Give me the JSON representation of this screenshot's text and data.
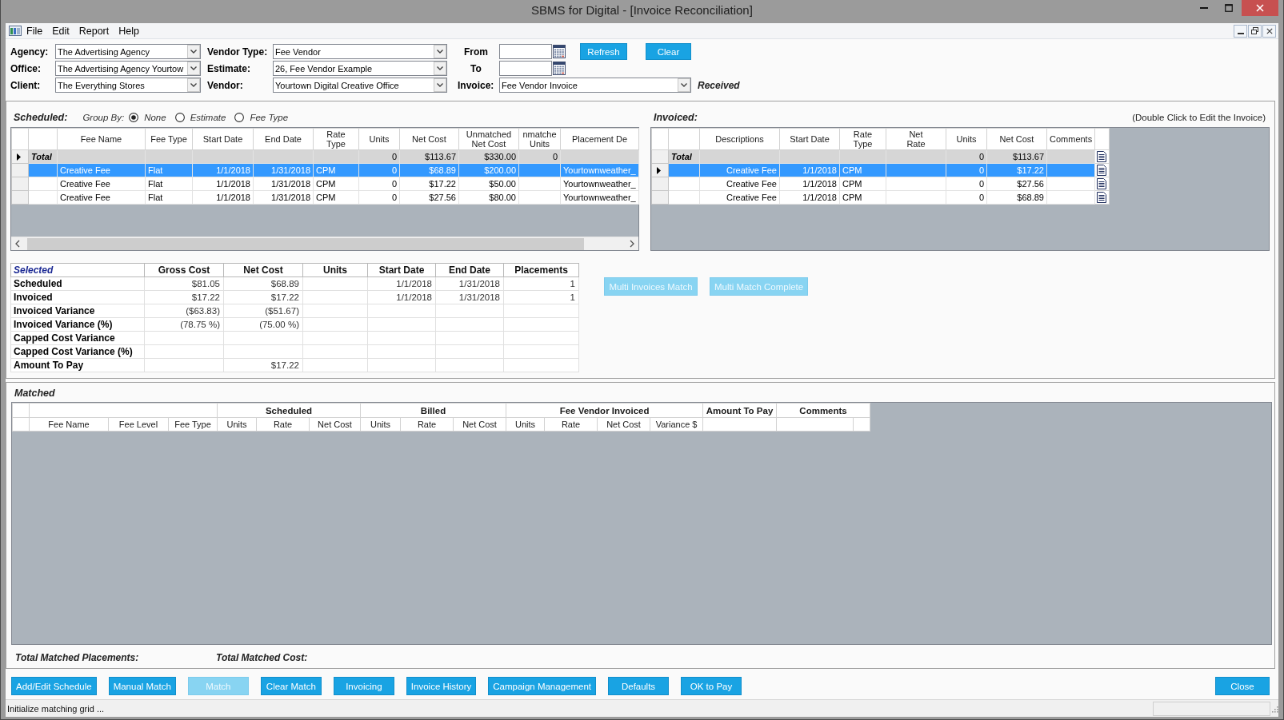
{
  "window": {
    "title": "SBMS for Digital - [Invoice Reconciliation]"
  },
  "menu": [
    "File",
    "Edit",
    "Report",
    "Help"
  ],
  "filters": {
    "account": [
      {
        "label": "Agency:",
        "value": "The Advertising Agency"
      },
      {
        "label": "Office:",
        "value": "The Advertising Agency Yourtow"
      },
      {
        "label": "Client:",
        "value": "The Everything Stores"
      }
    ],
    "vendor": [
      {
        "label": "Vendor Type:",
        "value": "Fee Vendor"
      },
      {
        "label": "Estimate:",
        "value": "26, Fee Vendor Example"
      },
      {
        "label": "Vendor:",
        "value": "Yourtown Digital Creative Office"
      }
    ],
    "date_range": [
      {
        "label": "From"
      },
      {
        "label": "To"
      }
    ],
    "buttons": [
      "Refresh",
      "Clear"
    ],
    "invoice": {
      "label": "Invoice:",
      "value": "Fee Vendor Invoice",
      "status": "Received"
    }
  },
  "scheduled": {
    "title": "Scheduled:",
    "group_by": {
      "label": "Group By:",
      "options": [
        {
          "label": "None",
          "selected": true
        },
        {
          "label": "Estimate",
          "selected": false
        },
        {
          "label": "Fee Type",
          "selected": false
        }
      ]
    },
    "columns": [
      "Fee Name",
      "Fee Type",
      "Start Date",
      "End Date",
      "Rate Type",
      "Units",
      "Net Cost",
      "Unmatched Net Cost",
      "nmatche Units",
      "Placement De"
    ],
    "total": {
      "label": "Total",
      "current": true,
      "units": "0",
      "net_cost": "$113.67",
      "unmatched_net_cost": "$330.00",
      "unmatched_units": "0"
    },
    "rows": [
      {
        "selected": true,
        "current": false,
        "fee_name": "Creative Fee",
        "fee_type": "Flat",
        "start_date": "1/1/2018",
        "end_date": "1/31/2018",
        "rate_type": "CPM",
        "units": "0",
        "net_cost": "$68.89",
        "unmatched_net_cost": "$200.00",
        "placement": "Yourtownweather_"
      },
      {
        "selected": false,
        "current": false,
        "fee_name": "Creative Fee",
        "fee_type": "Flat",
        "start_date": "1/1/2018",
        "end_date": "1/31/2018",
        "rate_type": "CPM",
        "units": "0",
        "net_cost": "$17.22",
        "unmatched_net_cost": "$50.00",
        "placement": "Yourtownweather_"
      },
      {
        "selected": false,
        "current": false,
        "fee_name": "Creative Fee",
        "fee_type": "Flat",
        "start_date": "1/1/2018",
        "end_date": "1/31/2018",
        "rate_type": "CPM",
        "units": "0",
        "net_cost": "$27.56",
        "unmatched_net_cost": "$80.00",
        "placement": "Yourtownweather_"
      }
    ]
  },
  "invoiced": {
    "title": "Invoiced:",
    "hint": "(Double Click to Edit the Invoice)",
    "columns": [
      "Descriptions",
      "Start Date",
      "Rate Type",
      "Net Rate",
      "Units",
      "Net Cost",
      "Comments"
    ],
    "total": {
      "label": "Total",
      "current": false,
      "units": "0",
      "net_cost": "$113.67"
    },
    "rows": [
      {
        "selected": true,
        "current": true,
        "description": "Creative Fee",
        "start_date": "1/1/2018",
        "rate_type": "CPM",
        "units": "0",
        "net_cost": "$17.22"
      },
      {
        "selected": false,
        "current": false,
        "description": "Creative Fee",
        "start_date": "1/1/2018",
        "rate_type": "CPM",
        "units": "0",
        "net_cost": "$27.56"
      },
      {
        "selected": false,
        "current": false,
        "description": "Creative Fee",
        "start_date": "1/1/2018",
        "rate_type": "CPM",
        "units": "0",
        "net_cost": "$68.89"
      }
    ]
  },
  "summary": {
    "title": "Selected",
    "columns": [
      "Gross Cost",
      "Net Cost",
      "Units",
      "Start Date",
      "End Date",
      "Placements"
    ],
    "rows": [
      {
        "label": "Scheduled",
        "gross_cost": "$81.05",
        "net_cost": "$68.89",
        "start_date": "1/1/2018",
        "end_date": "1/31/2018",
        "placements": "1"
      },
      {
        "label": "Invoiced",
        "gross_cost": "$17.22",
        "net_cost": "$17.22",
        "start_date": "1/1/2018",
        "end_date": "1/31/2018",
        "placements": "1"
      },
      {
        "label": "Invoiced Variance",
        "gross_cost": "($63.83)",
        "net_cost": "($51.67)"
      },
      {
        "label": "Invoiced Variance (%)",
        "gross_cost": "(78.75 %)",
        "net_cost": "(75.00 %)"
      },
      {
        "label": "Capped Cost Variance"
      },
      {
        "label": "Capped Cost Variance (%)"
      },
      {
        "label": "Amount To Pay",
        "net_cost": "$17.22"
      }
    ]
  },
  "multi_match_buttons": [
    {
      "label": "Multi Invoices Match",
      "disabled": true
    },
    {
      "label": "Multi Match Complete",
      "disabled": true
    }
  ],
  "matched": {
    "title": "Matched",
    "column_groups": [
      {
        "columns": [
          "Fee Name",
          "Fee Level",
          "Fee Type"
        ]
      },
      {
        "label": "Scheduled",
        "columns": [
          "Units",
          "Rate",
          "Net Cost"
        ]
      },
      {
        "label": "Billed",
        "columns": [
          "Units",
          "Rate",
          "Net Cost"
        ]
      },
      {
        "label": "Fee Vendor Invoiced",
        "columns": [
          "Units",
          "Rate",
          "Net Cost",
          "Variance $"
        ]
      },
      {
        "label": "Amount To Pay"
      },
      {
        "label": "Comments"
      }
    ],
    "totals": [
      "Total Matched Placements:",
      "Total Matched Cost:"
    ]
  },
  "actions": [
    {
      "label": "Add/Edit Schedule",
      "disabled": false
    },
    {
      "label": "Manual Match",
      "disabled": false
    },
    {
      "label": "Match",
      "disabled": true
    },
    {
      "label": "Clear Match",
      "disabled": false
    },
    {
      "label": "Invoicing",
      "disabled": false
    },
    {
      "label": "Invoice History",
      "disabled": false
    },
    {
      "label": "Campaign Management",
      "disabled": false
    },
    {
      "label": "Defaults",
      "disabled": false
    },
    {
      "label": "OK to Pay",
      "disabled": false
    }
  ],
  "close_button": "Close",
  "status_bar": {
    "message": "Initialize matching grid ..."
  }
}
